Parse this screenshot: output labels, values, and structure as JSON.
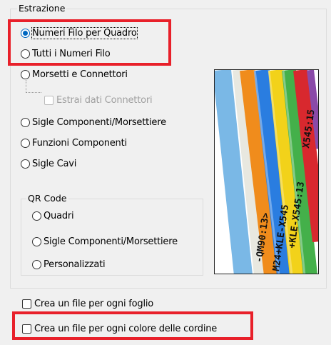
{
  "extraction_group": {
    "title": "Estrazione",
    "options": [
      {
        "label": "Numeri Filo per Quadro",
        "checked": true
      },
      {
        "label": "Tutti i Numeri Filo",
        "checked": false
      },
      {
        "label": "Morsetti e Connettori",
        "checked": false
      },
      {
        "label": "Sigle Componenti/Morsettiere",
        "checked": false
      },
      {
        "label": "Funzioni Componenti",
        "checked": false
      },
      {
        "label": "Sigle Cavi",
        "checked": false
      }
    ],
    "connector_data_checkbox": {
      "label": "Estrai dati Connettori",
      "checked": false,
      "enabled": false
    }
  },
  "qr_group": {
    "title": "QR Code",
    "options": [
      {
        "label": "Quadri",
        "checked": false
      },
      {
        "label": "Sigle Componenti/Morsettiere",
        "checked": false
      },
      {
        "label": "Personalizzati",
        "checked": false
      }
    ]
  },
  "file_options": [
    {
      "label": "Crea un file per ogni foglio",
      "checked": false
    },
    {
      "label": "Crea un file per ogni colore delle cordine",
      "checked": false
    }
  ],
  "preview_image": {
    "icon": "wire-markers-illustration",
    "marker_texts": [
      "-QM90:13>",
      "M24+KLE-X545",
      "+KLE-X545:13",
      "X545:15"
    ]
  },
  "colors": {
    "highlight": "#e8202a",
    "accent": "#0067c0",
    "background": "#f0f0f0"
  }
}
